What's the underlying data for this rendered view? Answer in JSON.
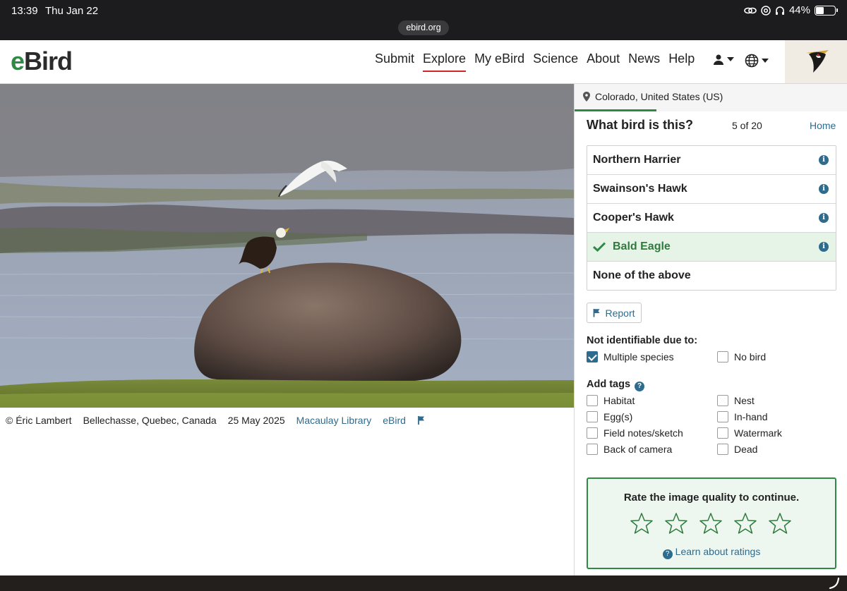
{
  "status": {
    "time": "13:39",
    "date": "Thu Jan 22",
    "battery": "44%",
    "battery_level": 0.44
  },
  "browser": {
    "url": "ebird.org"
  },
  "header": {
    "logo_e": "e",
    "logo_rest": "Bird",
    "nav": [
      "Submit",
      "Explore",
      "My eBird",
      "Science",
      "About",
      "News",
      "Help"
    ],
    "active_nav": "Explore"
  },
  "photo": {
    "credit": "© Éric Lambert",
    "location": "Bellechasse, Quebec, Canada",
    "date": "25 May 2025",
    "library_link": "Macaulay Library",
    "ebird_link": "eBird"
  },
  "quiz": {
    "location": "Colorado, United States (US)",
    "title": "What bird is this?",
    "progress": "5 of 20",
    "home": "Home",
    "choices": [
      {
        "label": "Northern Harrier",
        "selected": false,
        "info": "i"
      },
      {
        "label": "Swainson's Hawk",
        "selected": false,
        "info": "i"
      },
      {
        "label": "Cooper's Hawk",
        "selected": false,
        "info": "i"
      },
      {
        "label": "Bald Eagle",
        "selected": true,
        "info": "i"
      },
      {
        "label": "None of the above",
        "selected": false
      }
    ],
    "report": "Report",
    "not_identifiable_label": "Not identifiable due to:",
    "not_identifiable": [
      {
        "label": "Multiple species",
        "checked": true
      },
      {
        "label": "No bird",
        "checked": false
      }
    ],
    "tags_label": "Add tags",
    "tags_help": "?",
    "tags": [
      {
        "label": "Habitat",
        "checked": false
      },
      {
        "label": "Nest",
        "checked": false
      },
      {
        "label": "Egg(s)",
        "checked": false
      },
      {
        "label": "In-hand",
        "checked": false
      },
      {
        "label": "Field notes/sketch",
        "checked": false
      },
      {
        "label": "Watermark",
        "checked": false
      },
      {
        "label": "Back of camera",
        "checked": false
      },
      {
        "label": "Dead",
        "checked": false
      }
    ],
    "rating": {
      "prompt": "Rate the image quality to continue.",
      "stars": 5,
      "selected": 0,
      "learn": "Learn about ratings",
      "learn_icon": "?"
    }
  },
  "colors": {
    "brand_green": "#2f8a46",
    "link_blue": "#2e6b8c",
    "active_red": "#d0262a"
  }
}
